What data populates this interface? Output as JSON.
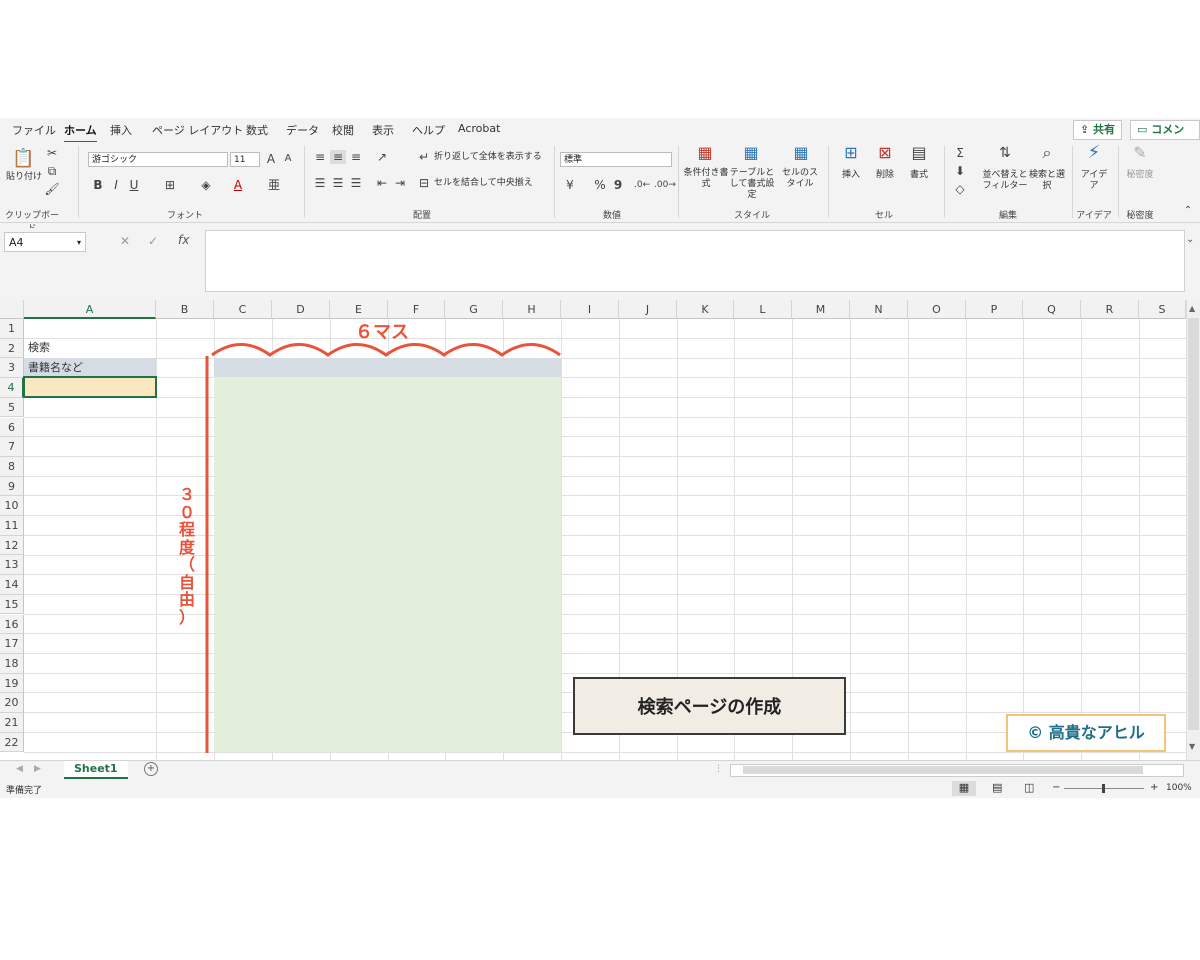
{
  "ribbon": {
    "tabs": [
      "ファイル",
      "ホーム",
      "挿入",
      "ページ レイアウト",
      "数式",
      "データ",
      "校閲",
      "表示",
      "ヘルプ",
      "Acrobat"
    ],
    "active_tab": "ホーム",
    "share": "共有",
    "comment": "コメント",
    "groups": [
      "クリップボード",
      "フォント",
      "配置",
      "数値",
      "スタイル",
      "セル",
      "編集",
      "アイデア",
      "秘密度"
    ],
    "clipboard": {
      "paste": "貼り付け"
    },
    "font": {
      "name": "游ゴシック",
      "size": "11",
      "bold": "B",
      "italic": "I",
      "underline": "U"
    },
    "alignment": {
      "wrap": "折り返して全体を表示する",
      "merge": "セルを結合して中央揃え"
    },
    "number": {
      "format": "標準",
      "percent": "%",
      "comma": "9"
    },
    "styles": {
      "conditional": "条件付き書式",
      "table": "テーブルとして書式設定",
      "cell": "セルのスタイル"
    },
    "cells": {
      "insert": "挿入",
      "delete": "削除",
      "format": "書式"
    },
    "editing": {
      "sort": "並べ替えとフィルター",
      "find": "検索と選択"
    },
    "ideas": "アイデア",
    "sensitivity": "秘密度"
  },
  "formula_bar": {
    "name_box": "A4",
    "cancel": "✕",
    "enter": "✓",
    "fx": "fx"
  },
  "grid": {
    "columns": [
      "A",
      "B",
      "C",
      "D",
      "E",
      "F",
      "G",
      "H",
      "I",
      "J",
      "K",
      "L",
      "M",
      "N",
      "O",
      "P",
      "Q",
      "R",
      "S"
    ],
    "rows": [
      "1",
      "2",
      "3",
      "4",
      "5",
      "6",
      "7",
      "8",
      "9",
      "10",
      "11",
      "12",
      "13",
      "14",
      "15",
      "16",
      "17",
      "18",
      "19",
      "20",
      "21",
      "22"
    ],
    "cells": {
      "A2": "検索",
      "A3": "書籍名など"
    }
  },
  "sheet_tabs": [
    "Sheet1"
  ],
  "status": {
    "ready": "準備完了",
    "zoom": "100%"
  },
  "annotations": {
    "top": "６マス",
    "side": [
      "３",
      "０",
      "程",
      "度",
      "（",
      "自",
      "由",
      "）"
    ],
    "title": "検索ページの作成",
    "credit": "© 高貴なアヒル"
  },
  "colors": {
    "header_fill": "#d6dce4",
    "body_fill": "#e2efda",
    "selected_fill": "#fbe8c1",
    "accent": "#217346",
    "annotation": "#e8533a"
  }
}
